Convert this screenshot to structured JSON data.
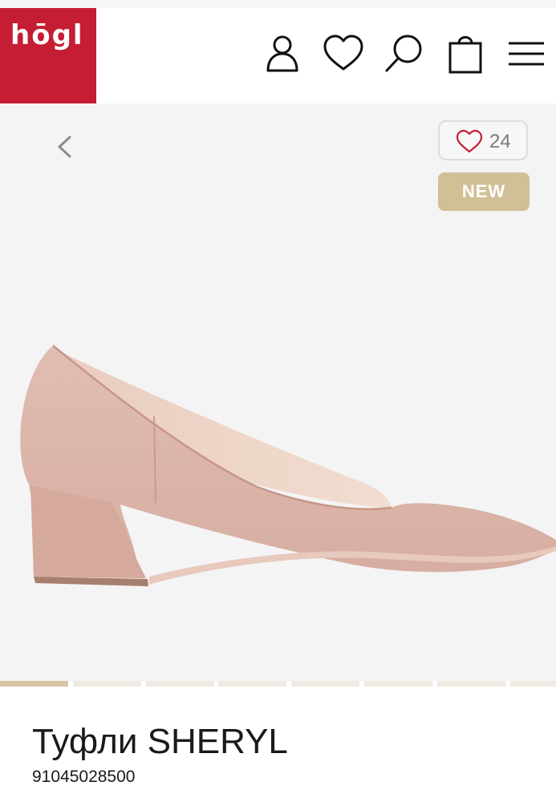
{
  "brand": {
    "logo_text": "hōgl",
    "color": "#c51d34"
  },
  "header": {
    "icons": [
      "account-icon",
      "wishlist-icon",
      "search-icon",
      "cart-icon",
      "menu-icon"
    ]
  },
  "gallery": {
    "wishlist_count": "24",
    "badge": "NEW",
    "badge_color": "#d1c096",
    "slides_total": 8,
    "active_slide": 1
  },
  "product": {
    "title": "Туфли SHERYL",
    "sku": "91045028500",
    "color": "#dcb6ab"
  }
}
